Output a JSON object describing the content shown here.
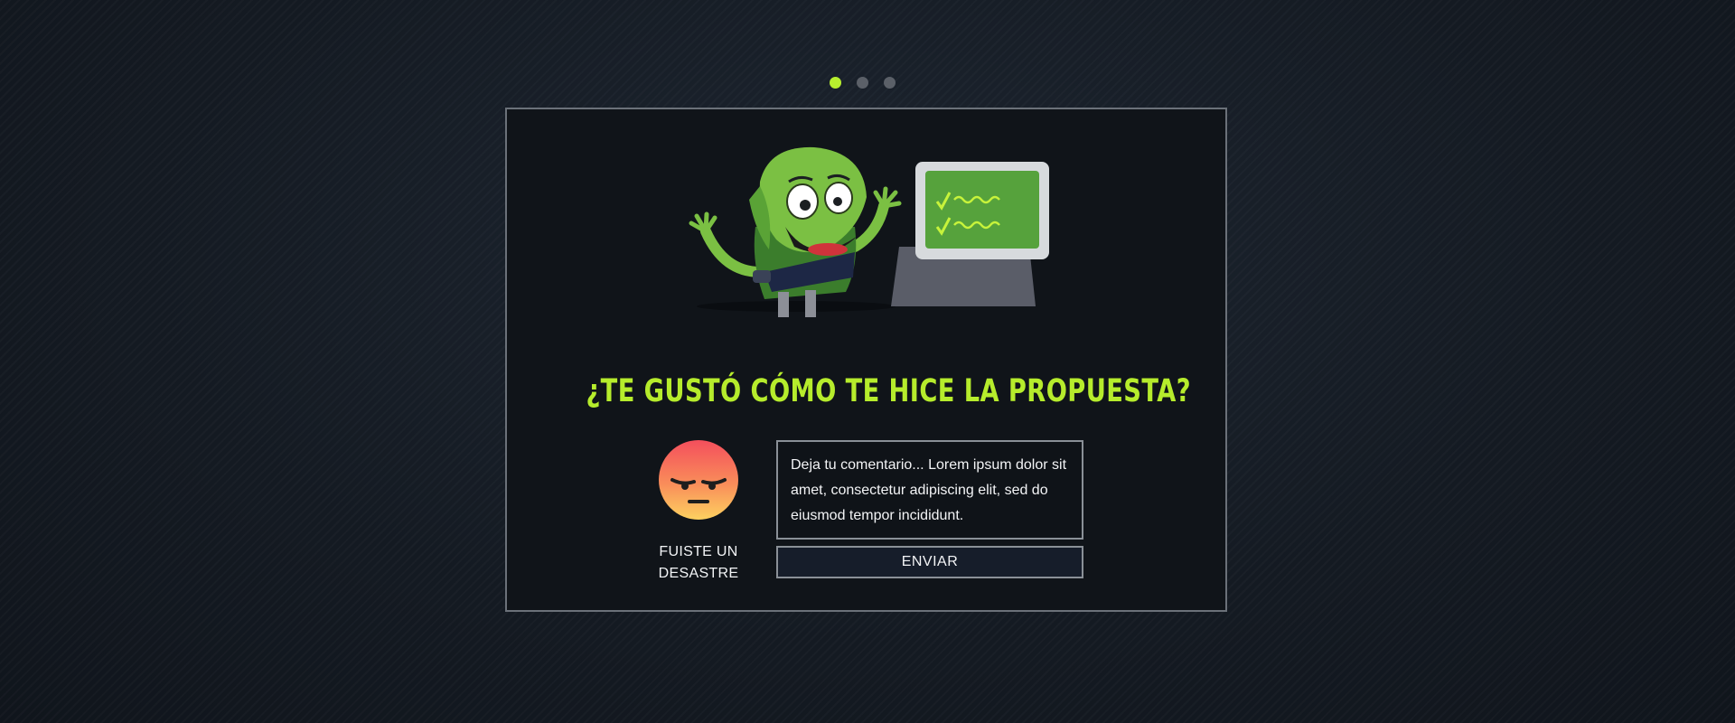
{
  "pager": {
    "dots": [
      {
        "label": "1",
        "active": true
      },
      {
        "label": "2",
        "active": false
      },
      {
        "label": "3",
        "active": false
      }
    ],
    "active_color": "#b7ef2e",
    "inactive_color": "#5b6068"
  },
  "card": {
    "question": "¿TE GUSTÓ CÓMO TE HICE LA PROPUESTA?",
    "accent_color": "#b6ec2c",
    "illustration": {
      "icon": "green-monster-with-computer-illustration"
    },
    "rating": {
      "icon": "angry-face-icon",
      "label": "FUISTE UN DESASTRE"
    },
    "comment": {
      "value": "Deja tu comentario... Lorem ipsum dolor sit amet, consectetur adipiscing elit, sed do eiusmod tempor incididunt."
    },
    "submit_label": "ENVIAR"
  }
}
